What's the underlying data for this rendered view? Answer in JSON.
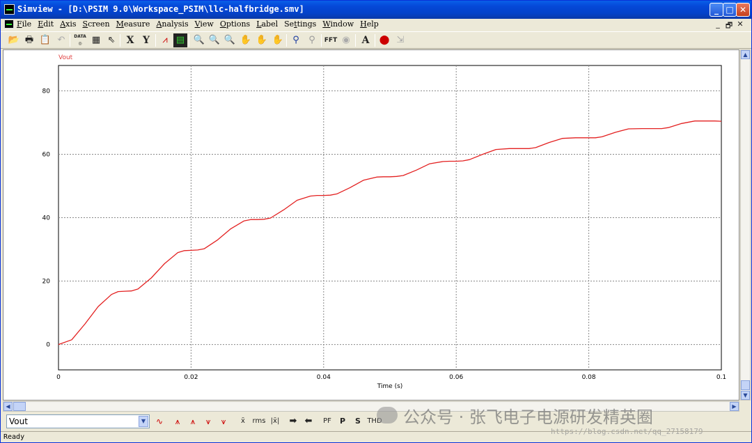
{
  "window": {
    "title": "Simview - [D:\\PSIM 9.0\\Workspace_PSIM\\llc-halfbridge.smv]",
    "minimize": "_",
    "maximize": "□",
    "close": "✕"
  },
  "menu": {
    "items": [
      {
        "u": "F",
        "rest": "ile"
      },
      {
        "u": "E",
        "rest": "dit"
      },
      {
        "u": "A",
        "rest": "xis"
      },
      {
        "u": "S",
        "rest": "creen"
      },
      {
        "u": "M",
        "rest": "easure"
      },
      {
        "u": "A",
        "rest": "nalysis"
      },
      {
        "u": "V",
        "rest": "iew"
      },
      {
        "u": "O",
        "rest": "ptions"
      },
      {
        "u": "L",
        "rest": "abel"
      },
      {
        "u": "S",
        "rest": "ettings",
        "pre": "Se",
        "post": "tings",
        "mid": "t"
      },
      {
        "u": "W",
        "rest": "indow"
      },
      {
        "u": "H",
        "rest": "elp"
      }
    ],
    "mdi": [
      "_",
      "🗗",
      "✕"
    ]
  },
  "toolbar": {
    "x_label": "X",
    "y_label": "Y",
    "fft_label": "FFT",
    "a_label": "A",
    "data_label": "DATA"
  },
  "bottom_toolbar": {
    "selected_variable": "Vout",
    "buttons": [
      "x̄",
      "rms",
      "|x̄|",
      "➡",
      "⬅",
      "PF",
      "P",
      "S",
      "THD"
    ]
  },
  "status": {
    "text": "Ready"
  },
  "watermark": {
    "text": "公众号 · 张飞电子电源研发精英圈",
    "url": "https://blog.csdn.net/qq_27158179"
  },
  "colors": {
    "trace": "#e32020",
    "grid": "#888888",
    "label_red": "#e04040"
  },
  "chart_data": {
    "type": "line",
    "series": [
      {
        "name": "Vout",
        "x": [
          0,
          0.002,
          0.004,
          0.006,
          0.008,
          0.009,
          0.01,
          0.011,
          0.012,
          0.014,
          0.016,
          0.018,
          0.019,
          0.02,
          0.021,
          0.022,
          0.024,
          0.026,
          0.028,
          0.029,
          0.03,
          0.031,
          0.032,
          0.034,
          0.036,
          0.038,
          0.039,
          0.04,
          0.041,
          0.042,
          0.044,
          0.046,
          0.048,
          0.049,
          0.05,
          0.051,
          0.052,
          0.054,
          0.056,
          0.058,
          0.059,
          0.06,
          0.061,
          0.062,
          0.064,
          0.066,
          0.068,
          0.069,
          0.07,
          0.071,
          0.072,
          0.074,
          0.076,
          0.078,
          0.079,
          0.08,
          0.081,
          0.082,
          0.084,
          0.086,
          0.088,
          0.089,
          0.09,
          0.091,
          0.092,
          0.094,
          0.096,
          0.098,
          0.099,
          0.1
        ],
        "y": [
          0,
          1.5,
          6.5,
          12,
          15.8,
          16.7,
          16.8,
          16.9,
          17.5,
          21,
          25.5,
          29,
          29.6,
          29.7,
          29.8,
          30.2,
          33,
          36.5,
          39,
          39.4,
          39.4,
          39.5,
          39.9,
          42.5,
          45.5,
          46.8,
          47,
          47,
          47.1,
          47.5,
          49.5,
          51.8,
          52.8,
          52.9,
          52.9,
          53,
          53.3,
          55,
          57,
          57.7,
          57.8,
          57.8,
          57.9,
          58.3,
          60,
          61.5,
          61.8,
          61.8,
          61.8,
          61.8,
          62.1,
          63.7,
          65,
          65.2,
          65.2,
          65.2,
          65.2,
          65.5,
          66.9,
          68,
          68.1,
          68.1,
          68.1,
          68.1,
          68.4,
          69.7,
          70.5,
          70.5,
          70.5,
          70.4
        ]
      }
    ],
    "title": "Vout",
    "xlabel": "Time (s)",
    "ylabel": "",
    "xlim": [
      0,
      0.1
    ],
    "ylim": [
      -8,
      88
    ],
    "xticks": [
      0,
      0.02,
      0.04,
      0.06,
      0.08,
      0.1
    ],
    "xtick_labels": [
      "0",
      "0.02",
      "0.04",
      "0.06",
      "0.08",
      "0.1"
    ],
    "yticks": [
      0,
      20,
      40,
      60,
      80
    ],
    "ytick_labels": [
      "0",
      "20",
      "40",
      "60",
      "80"
    ],
    "grid": true
  }
}
